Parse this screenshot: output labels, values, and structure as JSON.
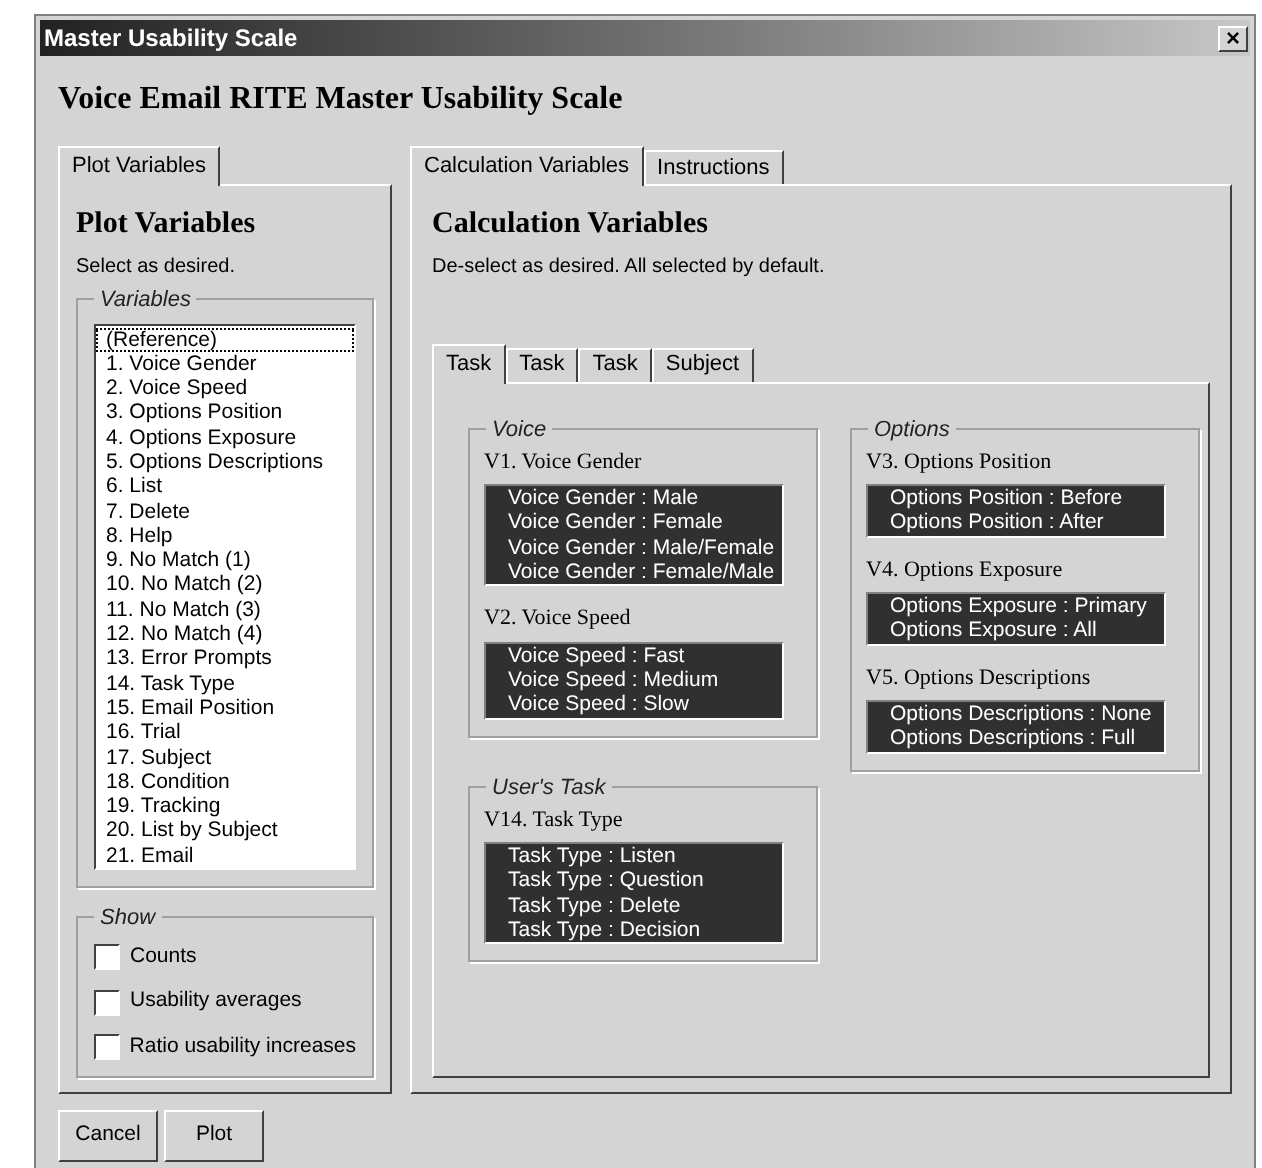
{
  "window": {
    "title": "Master Usability Scale",
    "close": "×"
  },
  "heading": "Voice Email RITE Master Usability Scale",
  "left_tabs": [
    {
      "label": "Plot Variables",
      "selected": true
    }
  ],
  "left": {
    "heading": "Plot Variables",
    "description": "Select as desired.",
    "variables": {
      "legend": "Variables",
      "items": [
        {
          "label": "(Reference)",
          "selected": false,
          "focused": true
        },
        {
          "label": "1. Voice Gender",
          "selected": false,
          "focused": false
        },
        {
          "label": "2. Voice Speed",
          "selected": false,
          "focused": false
        },
        {
          "label": "3. Options Position",
          "selected": false,
          "focused": false
        },
        {
          "label": "4. Options Exposure",
          "selected": false,
          "focused": false
        },
        {
          "label": "5. Options Descriptions",
          "selected": false,
          "focused": false
        },
        {
          "label": "6. List",
          "selected": false,
          "focused": false
        },
        {
          "label": "7. Delete",
          "selected": false,
          "focused": false
        },
        {
          "label": "8. Help",
          "selected": false,
          "focused": false
        },
        {
          "label": "9. No Match (1)",
          "selected": false,
          "focused": false
        },
        {
          "label": "10. No Match (2)",
          "selected": false,
          "focused": false
        },
        {
          "label": "11. No Match (3)",
          "selected": false,
          "focused": false
        },
        {
          "label": "12. No Match (4)",
          "selected": false,
          "focused": false
        },
        {
          "label": "13. Error Prompts",
          "selected": false,
          "focused": false
        },
        {
          "label": "14. Task Type",
          "selected": false,
          "focused": false
        },
        {
          "label": "15. Email Position",
          "selected": false,
          "focused": false
        },
        {
          "label": "16. Trial",
          "selected": false,
          "focused": false
        },
        {
          "label": "17. Subject",
          "selected": false,
          "focused": false
        },
        {
          "label": "18. Condition",
          "selected": false,
          "focused": false
        },
        {
          "label": "19. Tracking",
          "selected": false,
          "focused": false
        },
        {
          "label": "20. List by Subject",
          "selected": false,
          "focused": false
        },
        {
          "label": "21. Email",
          "selected": false,
          "focused": false
        }
      ]
    },
    "show": {
      "legend": "Show",
      "options": [
        {
          "label": "Counts",
          "checked": false
        },
        {
          "label": "Usability averages",
          "checked": false
        },
        {
          "label": "Ratio usability increases",
          "checked": false
        }
      ]
    }
  },
  "right_tabs": [
    {
      "label": "Calculation Variables",
      "selected": true
    },
    {
      "label": "Instructions",
      "selected": false
    }
  ],
  "right": {
    "heading": "Calculation Variables",
    "description": "De-select as desired. All selected by default.",
    "sub_tabs": [
      {
        "label": "Task",
        "selected": true
      },
      {
        "label": "Task",
        "selected": false
      },
      {
        "label": "Task",
        "selected": false
      },
      {
        "label": "Subject",
        "selected": false
      }
    ],
    "columns": [
      [
        {
          "legend": "Voice",
          "variables": [
            {
              "title": "V1. Voice Gender",
              "levels": [
                {
                  "label": "Voice Gender : Male",
                  "selected": true
                },
                {
                  "label": "Voice Gender : Female",
                  "selected": true
                },
                {
                  "label": "Voice Gender : Male/Female",
                  "selected": true
                },
                {
                  "label": "Voice Gender : Female/Male",
                  "selected": true
                }
              ]
            },
            {
              "title": "V2. Voice Speed",
              "levels": [
                {
                  "label": "Voice Speed : Fast",
                  "selected": true
                },
                {
                  "label": "Voice Speed : Medium",
                  "selected": true
                },
                {
                  "label": "Voice Speed : Slow",
                  "selected": true
                }
              ]
            }
          ]
        },
        {
          "legend": "User's Task",
          "variables": [
            {
              "title": "V14. Task Type",
              "levels": [
                {
                  "label": "Task Type : Listen",
                  "selected": true
                },
                {
                  "label": "Task Type : Question",
                  "selected": true
                },
                {
                  "label": "Task Type : Delete",
                  "selected": true
                },
                {
                  "label": "Task Type : Decision",
                  "selected": true
                }
              ]
            }
          ]
        }
      ],
      [
        {
          "legend": "Options",
          "variables": [
            {
              "title": "V3. Options Position",
              "levels": [
                {
                  "label": "Options Position : Before",
                  "selected": true
                },
                {
                  "label": "Options Position : After",
                  "selected": true
                }
              ]
            },
            {
              "title": "V4. Options Exposure",
              "levels": [
                {
                  "label": "Options Exposure : Primary",
                  "selected": true
                },
                {
                  "label": "Options Exposure : All",
                  "selected": true
                }
              ]
            },
            {
              "title": "V5. Options Descriptions",
              "levels": [
                {
                  "label": "Options Descriptions : None",
                  "selected": true
                },
                {
                  "label": "Options Descriptions : Full",
                  "selected": true
                }
              ]
            }
          ]
        }
      ]
    ]
  },
  "buttons": [
    {
      "label": "Cancel"
    },
    {
      "label": "Plot"
    }
  ]
}
